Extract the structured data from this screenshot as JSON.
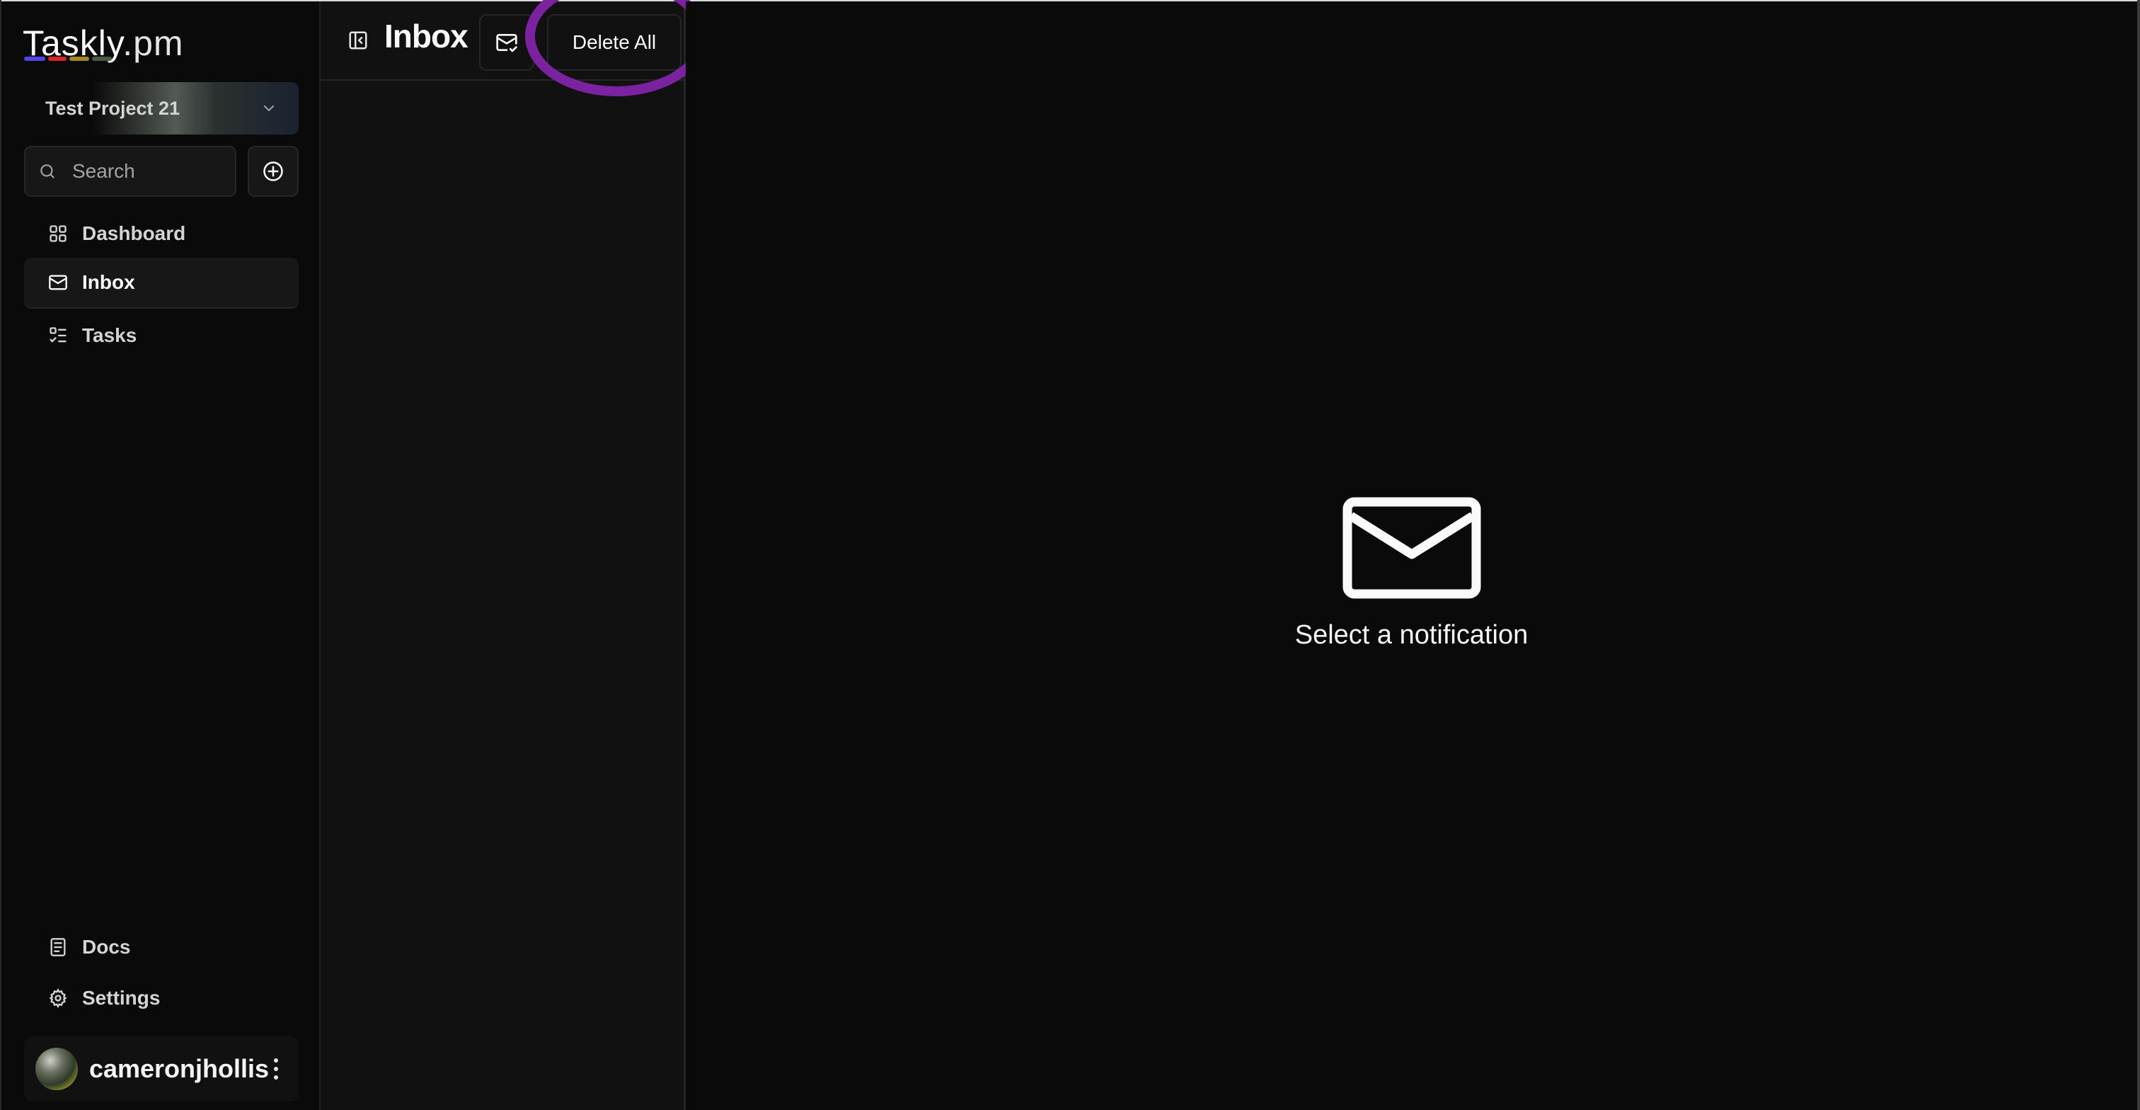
{
  "brand": {
    "name": "Taskly",
    "tld": ".pm",
    "bar_colors": [
      "#4f46e5",
      "#dc2626",
      "#a1891f",
      "#4b5a45"
    ]
  },
  "project_selector": {
    "name": "Test Project 21",
    "icon": "chevron-down-icon"
  },
  "search": {
    "placeholder": "Search",
    "value": "",
    "icon": "search-icon"
  },
  "add_button": {
    "icon": "plus-circle-icon"
  },
  "nav": {
    "items": [
      {
        "label": "Dashboard",
        "icon": "grid-icon",
        "active": false
      },
      {
        "label": "Inbox",
        "icon": "mail-icon",
        "active": true
      },
      {
        "label": "Tasks",
        "icon": "list-check-icon",
        "active": false
      }
    ],
    "bottom_items": [
      {
        "label": "Docs",
        "icon": "document-icon"
      },
      {
        "label": "Settings",
        "icon": "gear-icon"
      }
    ]
  },
  "user": {
    "username": "cameronjhollis",
    "menu_icon": "more-vertical-icon"
  },
  "inbox_panel": {
    "title": "Inbox",
    "toggle_icon": "panel-left-close-icon",
    "mark_read_icon": "mail-check-icon",
    "delete_all_label": "Delete All",
    "notifications": []
  },
  "detail": {
    "empty_icon": "mail-icon",
    "empty_text": "Select a notification"
  },
  "annotation": {
    "color": "#7b22a0",
    "target": "Delete All"
  }
}
